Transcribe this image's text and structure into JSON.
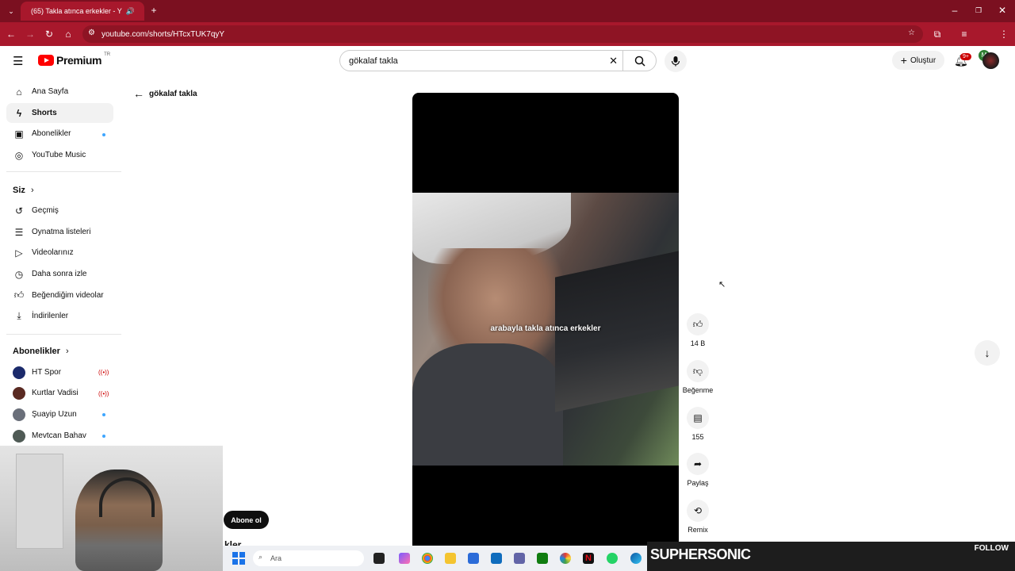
{
  "browser": {
    "tab_title": "(65) Takla atınca erkekler - Y",
    "url": "youtube.com/shorts/HTcxTUK7qyY"
  },
  "header": {
    "logo_text": "Premium",
    "logo_region": "TR",
    "search_value": "gökalaf takla",
    "create_label": "Oluştur",
    "notification_count": "9+"
  },
  "sidebar": {
    "main": [
      {
        "label": "Ana Sayfa",
        "icon": "home-icon"
      },
      {
        "label": "Shorts",
        "icon": "shorts-icon"
      },
      {
        "label": "Abonelikler",
        "icon": "subscriptions-icon"
      },
      {
        "label": "YouTube Music",
        "icon": "music-icon"
      }
    ],
    "you_heading": "Siz",
    "you": [
      {
        "label": "Geçmiş",
        "icon": "history-icon"
      },
      {
        "label": "Oynatma listeleri",
        "icon": "playlist-icon"
      },
      {
        "label": "Videolarınız",
        "icon": "your-videos-icon"
      },
      {
        "label": "Daha sonra izle",
        "icon": "watch-later-icon"
      },
      {
        "label": "Beğendiğim videolar",
        "icon": "liked-icon"
      },
      {
        "label": "İndirilenler",
        "icon": "download-icon"
      }
    ],
    "subs_heading": "Abonelikler",
    "subs": [
      {
        "label": "HT Spor",
        "status": "live",
        "color": "#1b2a6b"
      },
      {
        "label": "Kurtlar Vadisi",
        "status": "live",
        "color": "#5a2a22"
      },
      {
        "label": "Şuayip Uzun",
        "status": "new",
        "color": "#6a6f7a"
      },
      {
        "label": "Mevtcan Bahav",
        "status": "new",
        "color": "#4f5a55"
      }
    ]
  },
  "shorts": {
    "back_query": "gökalaf takla",
    "caption": "arabayla takla atınca erkekler",
    "likes": "14 B",
    "dislike_label": "Beğenme",
    "comments": "155",
    "share_label": "Paylaş",
    "remix_label": "Remix",
    "subscribe_label": "Abone ol",
    "channel_fragment": "kler"
  },
  "taskbar": {
    "search_placeholder": "Ara"
  },
  "overlay": {
    "streamer_name": "SUPHERSONIC",
    "follow_label": "FOLLOW"
  },
  "colors": {
    "chrome_dark": "#7b1020",
    "chrome_light": "#a8182c",
    "yt_red": "#ff0000"
  }
}
